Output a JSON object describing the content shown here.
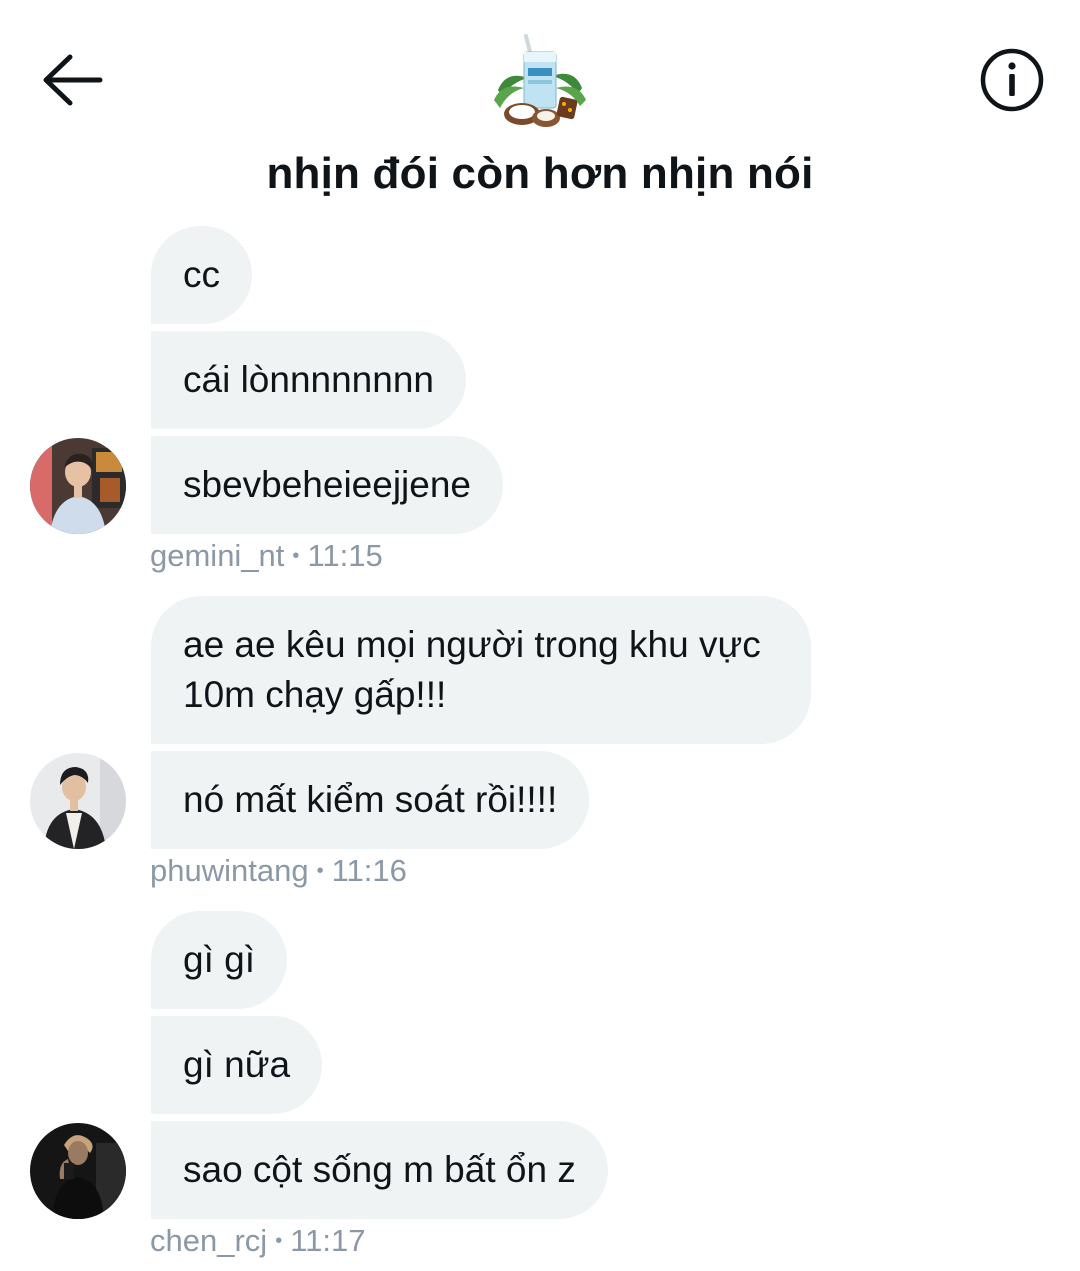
{
  "header": {
    "title": "nhịn đói còn hơn nhịn nói",
    "back_icon": "arrow-left-icon",
    "info_icon": "info-circle-icon"
  },
  "messages": [
    {
      "text": "cc"
    },
    {
      "text": "cái lònnnnnnnn"
    },
    {
      "text": "sbevbeheieejjene"
    },
    {
      "text": "ae ae kêu mọi người trong khu vực 10m chạy gấp!!!"
    },
    {
      "text": "nó mất kiểm soát rồi!!!!"
    },
    {
      "text": "gì gì"
    },
    {
      "text": "gì nữa"
    },
    {
      "text": "sao cột sống m bất ổn z"
    }
  ],
  "groups": [
    {
      "username": "gemini_nt",
      "time": "11:15"
    },
    {
      "username": "phuwintang",
      "time": "11:16"
    },
    {
      "username": "chen_rcj",
      "time": "11:17"
    }
  ],
  "separator": "•",
  "colors": {
    "bubble": "#eff3f4",
    "text": "#0f1419",
    "meta": "#8b98a5"
  }
}
